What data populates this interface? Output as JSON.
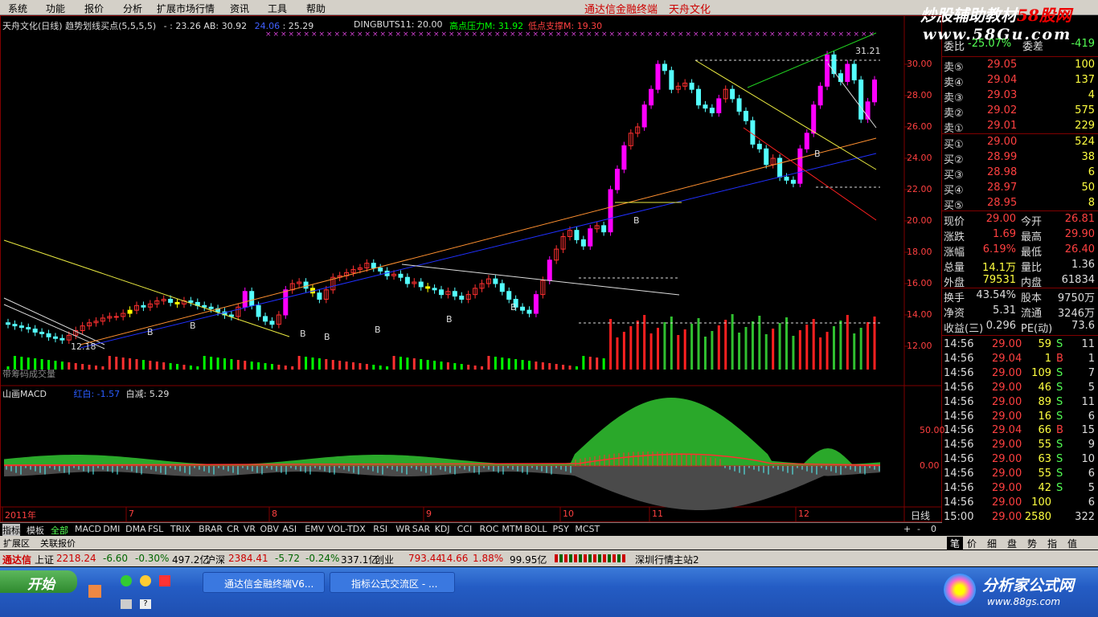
{
  "menu": [
    "系统",
    "功能",
    "报价",
    "分析",
    "扩展市场行情",
    "资讯",
    "工具",
    "帮助"
  ],
  "app_title": "通达信金融终端",
  "stock_title": "天舟文化",
  "watermark_top": {
    "prefix": "炒股辅助教材",
    "suffix": "58股网"
  },
  "watermark_url": "www.58Gu.com",
  "main_info": {
    "stock_period": "天舟文化(日线)",
    "indicator": "趋势划线买点(5,5,5,5)",
    "ab_label_a": "- : 23.26",
    "ab_label_b": "AB: 30.92",
    "val_blue": "24.06",
    "val_r": ": 25.29",
    "dingbuts": "DINGBUTS11: 20.00",
    "high_press": "高点压力M: 31.92",
    "low_support": "低点支撑M: 19.30"
  },
  "price_axis": [
    "30.00",
    "28.00",
    "26.00",
    "24.00",
    "22.00",
    "20.00",
    "18.00",
    "16.00",
    "14.00",
    "12.00"
  ],
  "macd_axis": [
    "50.00",
    "0.00"
  ],
  "point_labels": {
    "high": "31.21",
    "low": "12.18",
    "b_mark": "B"
  },
  "volume_label": "带筹码成交量",
  "macd_panel": {
    "name": "山画MACD",
    "dif": "红白: -1.57",
    "white_minus": "白减: 5.29"
  },
  "x_axis": [
    "2011年",
    "7",
    "8",
    "9",
    "10",
    "11",
    "12"
  ],
  "period_label": "日线",
  "quote": {
    "top_row": {
      "label": "委比",
      "pct": "-25.07%",
      "label2": "委差",
      "diff": "-419"
    },
    "asks": [
      {
        "label": "卖⑤",
        "price": "29.05",
        "vol": "100"
      },
      {
        "label": "卖④",
        "price": "29.04",
        "vol": "137"
      },
      {
        "label": "卖③",
        "price": "29.03",
        "vol": "4"
      },
      {
        "label": "卖②",
        "price": "29.02",
        "vol": "575"
      },
      {
        "label": "卖①",
        "price": "29.01",
        "vol": "229"
      }
    ],
    "bids": [
      {
        "label": "买①",
        "price": "29.00",
        "vol": "524"
      },
      {
        "label": "买②",
        "price": "28.99",
        "vol": "38"
      },
      {
        "label": "买③",
        "price": "28.98",
        "vol": "6"
      },
      {
        "label": "买④",
        "price": "28.97",
        "vol": "50"
      },
      {
        "label": "买⑤",
        "price": "28.95",
        "vol": "8"
      }
    ],
    "stats": [
      {
        "l1": "现价",
        "v1": "29.00",
        "l2": "今开",
        "v2": "26.81"
      },
      {
        "l1": "涨跌",
        "v1": "1.69",
        "l2": "最高",
        "v2": "29.90"
      },
      {
        "l1": "涨幅",
        "v1": "6.19%",
        "l2": "最低",
        "v2": "26.40"
      },
      {
        "l1": "总量",
        "v1": "14.1万",
        "l2": "量比",
        "v2": "1.36"
      },
      {
        "l1": "外盘",
        "v1": "79531",
        "l2": "内盘",
        "v2": "61834"
      },
      {
        "l1": "换手",
        "v1": "43.54%",
        "l2": "股本",
        "v2": "9750万"
      },
      {
        "l1": "净资",
        "v1": "5.31",
        "l2": "流通",
        "v2": "3246万"
      },
      {
        "l1": "收益(三)",
        "v1": "0.296",
        "l2": "PE(动)",
        "v2": "73.6"
      }
    ],
    "ticks": [
      {
        "t": "14:56",
        "p": "29.00",
        "v": "59",
        "bs": "S",
        "n": "11"
      },
      {
        "t": "14:56",
        "p": "29.04",
        "v": "1",
        "bs": "B",
        "n": "1"
      },
      {
        "t": "14:56",
        "p": "29.00",
        "v": "109",
        "bs": "S",
        "n": "7"
      },
      {
        "t": "14:56",
        "p": "29.00",
        "v": "46",
        "bs": "S",
        "n": "5"
      },
      {
        "t": "14:56",
        "p": "29.00",
        "v": "89",
        "bs": "S",
        "n": "11"
      },
      {
        "t": "14:56",
        "p": "29.00",
        "v": "16",
        "bs": "S",
        "n": "6"
      },
      {
        "t": "14:56",
        "p": "29.04",
        "v": "66",
        "bs": "B",
        "n": "15"
      },
      {
        "t": "14:56",
        "p": "29.00",
        "v": "55",
        "bs": "S",
        "n": "9"
      },
      {
        "t": "14:56",
        "p": "29.00",
        "v": "63",
        "bs": "S",
        "n": "10"
      },
      {
        "t": "14:56",
        "p": "29.00",
        "v": "55",
        "bs": "S",
        "n": "6"
      },
      {
        "t": "14:56",
        "p": "29.00",
        "v": "42",
        "bs": "S",
        "n": "5"
      },
      {
        "t": "14:56",
        "p": "29.00",
        "v": "100",
        "bs": "",
        "n": "6"
      },
      {
        "t": "15:00",
        "p": "29.00",
        "v": "2580",
        "bs": "",
        "n": "322"
      }
    ]
  },
  "tabs": [
    "指标",
    "模板",
    "全部",
    "MACD",
    "DMI",
    "DMA",
    "FSL",
    "TRIX",
    "BRAR",
    "CR",
    "VR",
    "OBV",
    "ASI",
    "EMV",
    "VOL-TDX",
    "RSI",
    "WR",
    "SAR",
    "KDJ",
    "CCI",
    "ROC",
    "MTM",
    "BOLL",
    "PSY",
    "MCST"
  ],
  "tabs2": [
    "扩展区",
    "关联报价"
  ],
  "zoom_controls": [
    "+",
    "-",
    "0"
  ],
  "right_tabs": [
    "笔",
    "价",
    "细",
    "盘",
    "势",
    "指",
    "值"
  ],
  "status": {
    "brand": "通达信",
    "sh_label": "上证",
    "sh_val": "2218.24",
    "sh_chg": "-6.60",
    "sh_pct": "-0.30%",
    "sh_amt": "497.2亿",
    "sz_label": "沪深",
    "sz_val": "2384.41",
    "sz_chg": "-5.72",
    "sz_pct": "-0.24%",
    "sz_amt": "337.1亿",
    "cy_label": "创业",
    "cy_val": "793.44",
    "cy_chg": "14.66",
    "cy_pct": "1.88%",
    "cy_amt": "99.95亿",
    "server": "深圳行情主站2"
  },
  "taskbar": {
    "start": "开始",
    "task1": "通达信金融终端V6...",
    "task2": "指标公式交流区 - ..."
  },
  "logo": {
    "name": "分析家公式网",
    "url": "www.88gs.com"
  },
  "colors": {
    "up": "#ff3030",
    "down": "#54ffff",
    "yellow": "#ffff00",
    "magenta": "#ff00ff",
    "green": "#00c000"
  }
}
